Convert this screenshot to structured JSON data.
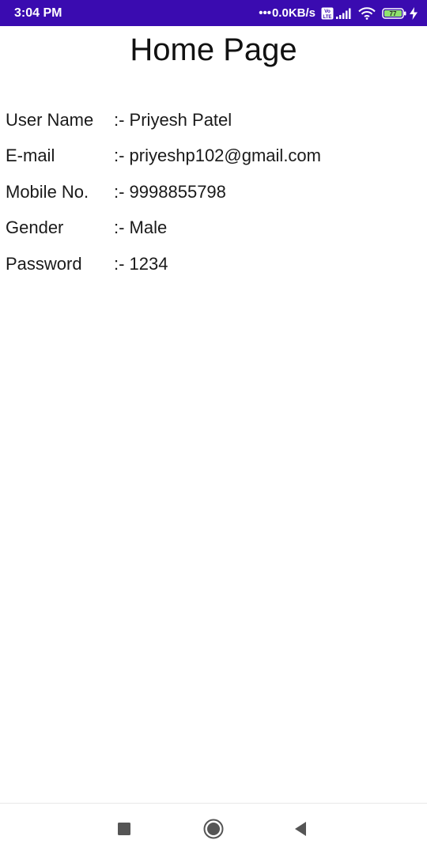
{
  "status_bar": {
    "time": "3:04 PM",
    "net_speed": "0.0KB/s",
    "volte_label": "Vo LTE",
    "battery": "77",
    "icons": [
      "volte-icon",
      "signal-icon",
      "wifi-icon",
      "battery-icon",
      "charging-icon"
    ],
    "background_color": "#3a0bb0"
  },
  "page": {
    "title": "Home Page"
  },
  "profile": {
    "rows": [
      {
        "label": "User Name",
        "value": ":- Priyesh Patel"
      },
      {
        "label": "E-mail",
        "value": ":- priyeshp102@gmail.com"
      },
      {
        "label": "Mobile No.",
        "value": ":- 9998855798"
      },
      {
        "label": "Gender",
        "value": ":- Male"
      },
      {
        "label": "Password",
        "value": ":- 1234"
      }
    ]
  },
  "nav_bar": {
    "buttons": [
      "recents-square-icon",
      "home-circle-icon",
      "back-triangle-icon"
    ]
  }
}
